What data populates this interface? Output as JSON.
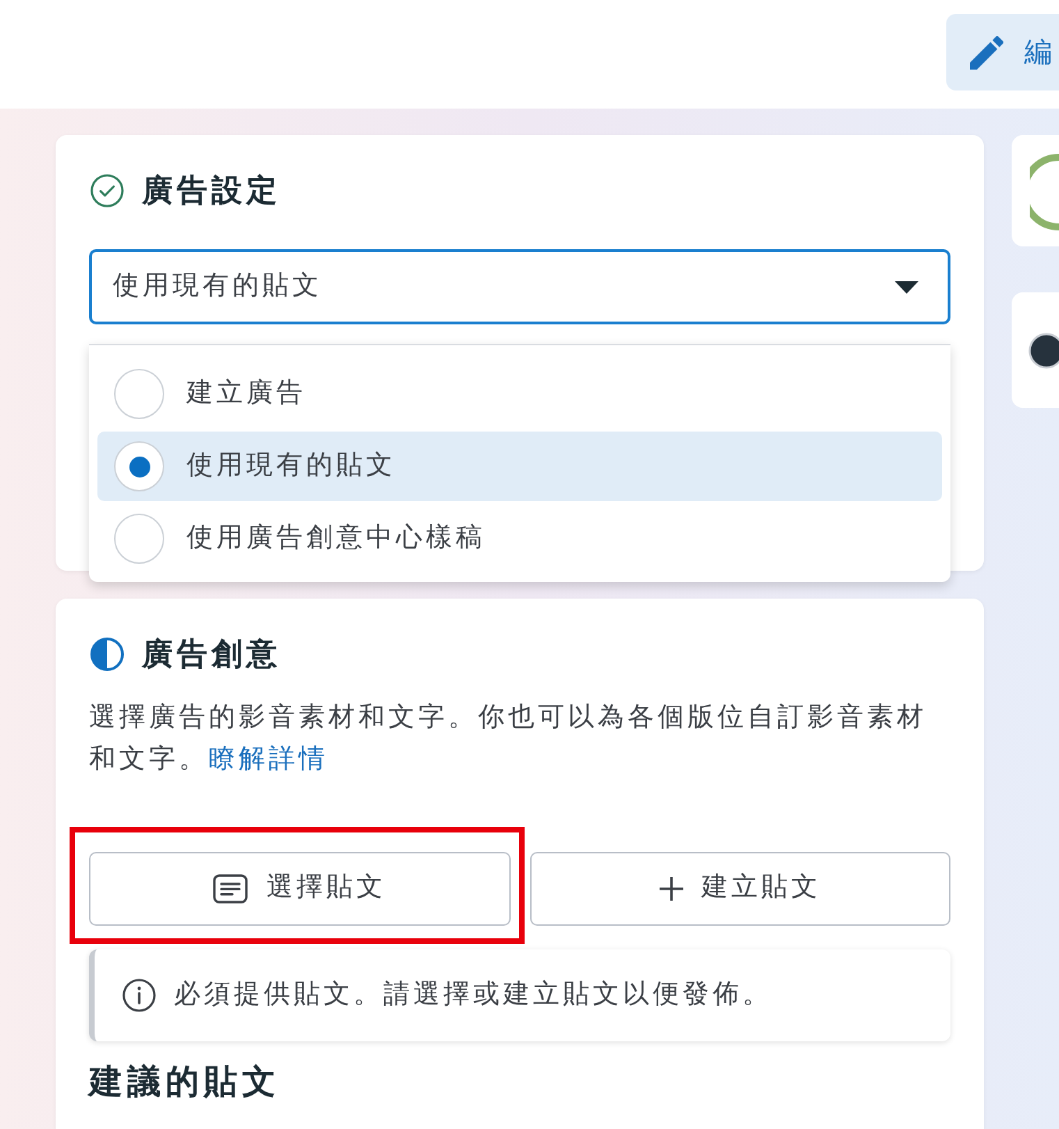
{
  "header": {
    "edit_button": {
      "label": "編"
    }
  },
  "ad_setup": {
    "title": "廣告設定",
    "complete": true,
    "select": {
      "value": "使用現有的貼文",
      "expanded": true
    },
    "options": [
      {
        "label": "建立廣告",
        "selected": false
      },
      {
        "label": "使用現有的貼文",
        "selected": true
      },
      {
        "label": "使用廣告創意中心樣稿",
        "selected": false
      }
    ]
  },
  "ad_creative": {
    "title": "廣告創意",
    "complete": false,
    "description": "選擇廣告的影音素材和文字。你也可以為各個版位自訂影音素材和文字。",
    "link": "瞭解詳情",
    "buttons": [
      {
        "label": "選擇貼文",
        "kind": "select",
        "highlighted": true
      },
      {
        "label": "建立貼文",
        "kind": "create",
        "highlighted": false
      }
    ],
    "notice": "必須提供貼文。請選擇或建立貼文以便發佈。",
    "suggested_heading": "建議的貼文"
  }
}
